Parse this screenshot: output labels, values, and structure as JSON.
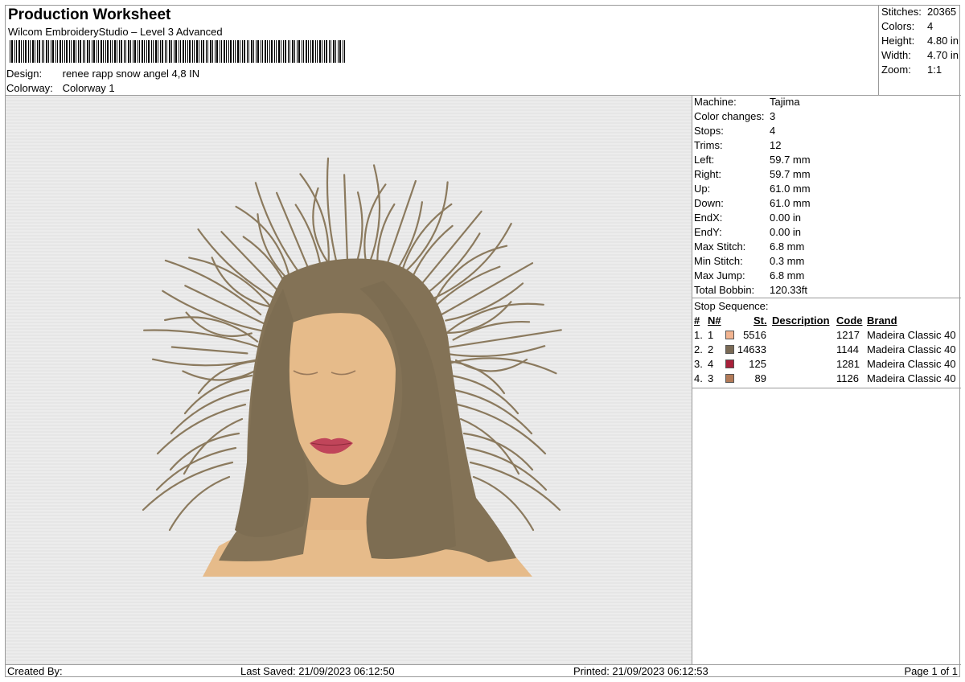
{
  "header": {
    "title": "Production Worksheet",
    "software": "Wilcom EmbroideryStudio – Level 3 Advanced",
    "design_label": "Design:",
    "design_value": "renee rapp snow angel 4,8 IN",
    "colorway_label": "Colorway:",
    "colorway_value": "Colorway 1"
  },
  "stats": [
    {
      "label": "Stitches:",
      "value": "20365"
    },
    {
      "label": "Colors:",
      "value": "4"
    },
    {
      "label": "Height:",
      "value": "4.80 in"
    },
    {
      "label": "Width:",
      "value": "4.70 in"
    },
    {
      "label": "Zoom:",
      "value": "1:1"
    }
  ],
  "machine": [
    {
      "label": "Machine:",
      "value": "Tajima"
    },
    {
      "label": "Color changes:",
      "value": "3"
    },
    {
      "label": "Stops:",
      "value": "4"
    },
    {
      "label": "Trims:",
      "value": "12"
    },
    {
      "label": "Left:",
      "value": "59.7 mm"
    },
    {
      "label": "Right:",
      "value": "59.7 mm"
    },
    {
      "label": "Up:",
      "value": "61.0 mm"
    },
    {
      "label": "Down:",
      "value": "61.0 mm"
    },
    {
      "label": "EndX:",
      "value": "0.00 in"
    },
    {
      "label": "EndY:",
      "value": "0.00 in"
    },
    {
      "label": "Max Stitch:",
      "value": "6.8 mm"
    },
    {
      "label": "Min Stitch:",
      "value": "0.3 mm"
    },
    {
      "label": "Max Jump:",
      "value": "6.8 mm"
    },
    {
      "label": "Total Bobbin:",
      "value": "120.33ft"
    }
  ],
  "stop_sequence": {
    "title": "Stop Sequence:",
    "headers": {
      "stop": "#",
      "needle": "N#",
      "stitches": "St.",
      "description": "Description",
      "code": "Code",
      "brand": "Brand"
    },
    "rows": [
      {
        "stop": "1.",
        "needle": "1",
        "color": "#f2b490",
        "stitches": "5516",
        "description": "",
        "code": "1217",
        "brand": "Madeira Classic 40"
      },
      {
        "stop": "2.",
        "needle": "2",
        "color": "#7a6a55",
        "stitches": "14633",
        "description": "",
        "code": "1144",
        "brand": "Madeira Classic 40"
      },
      {
        "stop": "3.",
        "needle": "4",
        "color": "#a8203a",
        "stitches": "125",
        "description": "",
        "code": "1281",
        "brand": "Madeira Classic 40"
      },
      {
        "stop": "4.",
        "needle": "3",
        "color": "#b27a58",
        "stitches": "89",
        "description": "",
        "code": "1126",
        "brand": "Madeira Classic 40"
      }
    ]
  },
  "footer": {
    "created_by": "Created By:",
    "last_saved": "Last Saved: 21/09/2023 06:12:50",
    "printed": "Printed: 21/09/2023 06:12:53",
    "page": "Page 1 of 1"
  },
  "colors": {
    "hair": "#857457",
    "skin": "#e6bb8a",
    "lips": "#c0455a",
    "background": "#e9e9e9"
  }
}
